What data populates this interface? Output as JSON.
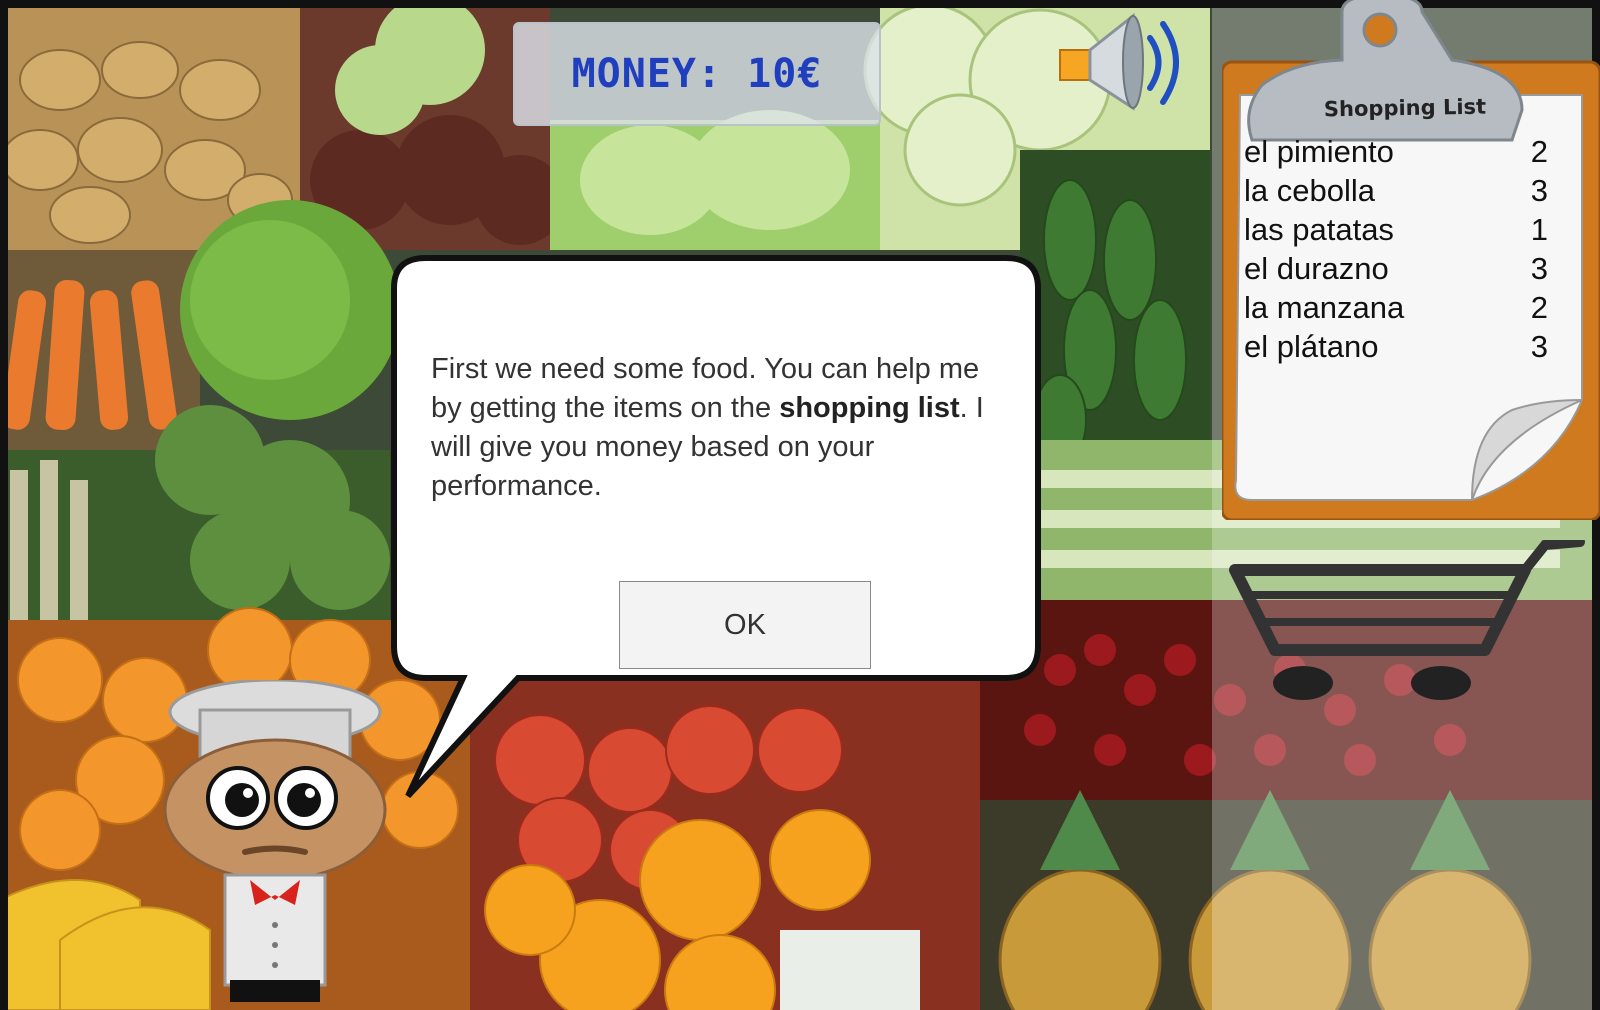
{
  "hud": {
    "money_text": "MONEY: 10€"
  },
  "shopping_list": {
    "title": "Shopping List",
    "items": [
      {
        "name": "el pimiento",
        "qty": "2"
      },
      {
        "name": "la cebolla",
        "qty": "3"
      },
      {
        "name": "las patatas",
        "qty": "1"
      },
      {
        "name": "el durazno",
        "qty": "3"
      },
      {
        "name": "la manzana",
        "qty": "2"
      },
      {
        "name": "el plátano",
        "qty": "3"
      }
    ]
  },
  "dialog": {
    "text_before": "First we need some food. You can help me by getting the items on the ",
    "text_bold": "shopping list",
    "text_after": ". I will give you money based on your performance.",
    "ok_label": "OK"
  },
  "icons": {
    "speaker": "speaker-icon",
    "cart": "shopping-cart-icon",
    "chef": "chef-character"
  }
}
